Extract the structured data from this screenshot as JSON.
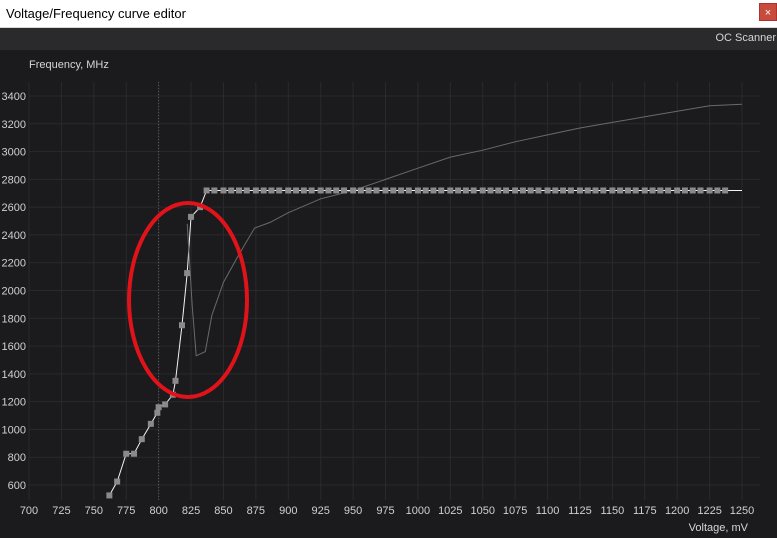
{
  "window": {
    "title": "Voltage/Frequency curve editor",
    "close_label": "×"
  },
  "toolbar": {
    "oc_scanner_label": "OC Scanner"
  },
  "chart_data": {
    "type": "line",
    "ylabel": "Frequency, MHz",
    "xlabel": "Voltage, mV",
    "xlim": [
      700,
      1250
    ],
    "ylim": [
      500,
      3450
    ],
    "x_ticks": [
      700,
      725,
      750,
      775,
      800,
      825,
      850,
      875,
      900,
      925,
      950,
      975,
      1000,
      1025,
      1050,
      1075,
      1100,
      1125,
      1150,
      1175,
      1200,
      1225,
      1250
    ],
    "y_ticks": [
      600,
      800,
      1000,
      1200,
      1400,
      1600,
      1800,
      2000,
      2200,
      2400,
      2600,
      2800,
      3000,
      3200,
      3400
    ],
    "grid": true,
    "vertical_marker_x": 800,
    "series": [
      {
        "role": "current-curve",
        "color": "#ffffff",
        "points": [
          [
            762,
            525
          ],
          [
            768,
            625
          ],
          [
            775,
            825
          ],
          [
            781,
            825
          ],
          [
            787,
            930
          ],
          [
            794,
            1040
          ],
          [
            799,
            1120
          ],
          [
            800,
            1160
          ],
          [
            805,
            1180
          ],
          [
            811,
            1250
          ],
          [
            813,
            1350
          ],
          [
            818,
            1750
          ],
          [
            822,
            2125
          ],
          [
            825,
            2530
          ],
          [
            832,
            2600
          ],
          [
            837,
            2720
          ],
          [
            843,
            2720
          ],
          [
            850,
            2720
          ],
          [
            856,
            2720
          ],
          [
            862,
            2720
          ],
          [
            868,
            2720
          ],
          [
            875,
            2720
          ],
          [
            881,
            2720
          ],
          [
            887,
            2720
          ],
          [
            893,
            2720
          ],
          [
            900,
            2720
          ],
          [
            906,
            2720
          ],
          [
            912,
            2720
          ],
          [
            918,
            2720
          ],
          [
            925,
            2720
          ],
          [
            931,
            2720
          ],
          [
            937,
            2720
          ],
          [
            943,
            2720
          ],
          [
            950,
            2720
          ],
          [
            956,
            2720
          ],
          [
            962,
            2720
          ],
          [
            968,
            2720
          ],
          [
            975,
            2720
          ],
          [
            981,
            2720
          ],
          [
            987,
            2720
          ],
          [
            993,
            2720
          ],
          [
            1000,
            2720
          ],
          [
            1006,
            2720
          ],
          [
            1012,
            2720
          ],
          [
            1018,
            2720
          ],
          [
            1025,
            2720
          ],
          [
            1031,
            2720
          ],
          [
            1037,
            2720
          ],
          [
            1043,
            2720
          ],
          [
            1050,
            2720
          ],
          [
            1056,
            2720
          ],
          [
            1062,
            2720
          ],
          [
            1068,
            2720
          ],
          [
            1075,
            2720
          ],
          [
            1081,
            2720
          ],
          [
            1087,
            2720
          ],
          [
            1093,
            2720
          ],
          [
            1100,
            2720
          ],
          [
            1106,
            2720
          ],
          [
            1112,
            2720
          ],
          [
            1118,
            2720
          ],
          [
            1125,
            2720
          ],
          [
            1131,
            2720
          ],
          [
            1137,
            2720
          ],
          [
            1143,
            2720
          ],
          [
            1150,
            2720
          ],
          [
            1156,
            2720
          ],
          [
            1162,
            2720
          ],
          [
            1168,
            2720
          ],
          [
            1175,
            2720
          ],
          [
            1181,
            2720
          ],
          [
            1187,
            2720
          ],
          [
            1193,
            2720
          ],
          [
            1200,
            2720
          ],
          [
            1206,
            2720
          ],
          [
            1212,
            2720
          ],
          [
            1218,
            2720
          ],
          [
            1225,
            2720
          ],
          [
            1231,
            2720
          ],
          [
            1237,
            2720
          ],
          [
            1250,
            2720
          ]
        ]
      },
      {
        "role": "default-curve",
        "color": "#6a6a6a",
        "points": [
          [
            822,
            2480
          ],
          [
            826,
            1880
          ],
          [
            829,
            1530
          ],
          [
            836,
            1560
          ],
          [
            841,
            1820
          ],
          [
            850,
            2060
          ],
          [
            862,
            2260
          ],
          [
            874,
            2450
          ],
          [
            886,
            2490
          ],
          [
            900,
            2560
          ],
          [
            925,
            2660
          ],
          [
            950,
            2720
          ],
          [
            975,
            2800
          ],
          [
            1000,
            2880
          ],
          [
            1025,
            2960
          ],
          [
            1050,
            3010
          ],
          [
            1075,
            3070
          ],
          [
            1100,
            3120
          ],
          [
            1125,
            3170
          ],
          [
            1150,
            3210
          ],
          [
            1175,
            3250
          ],
          [
            1200,
            3290
          ],
          [
            1225,
            3330
          ],
          [
            1250,
            3340
          ]
        ]
      }
    ]
  },
  "annotation": {
    "type": "ellipse",
    "color": "#e0131b"
  }
}
